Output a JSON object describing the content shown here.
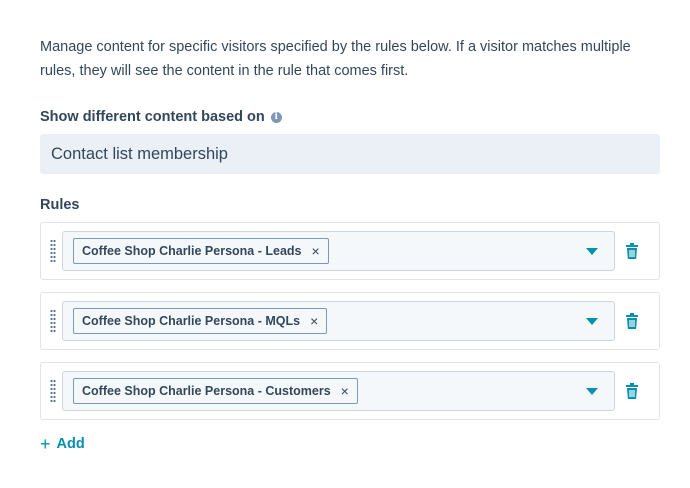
{
  "description": "Manage content for specific visitors specified by the rules below. If a visitor matches multiple rules, they will see the content in the rule that comes first.",
  "content_field": {
    "label": "Show different content based on",
    "info_icon": "i",
    "selected_value": "Contact list membership"
  },
  "rules": {
    "label": "Rules",
    "items": [
      {
        "tag": "Coffee Shop Charlie Persona - Leads",
        "remove": "×"
      },
      {
        "tag": "Coffee Shop Charlie Persona - MQLs",
        "remove": "×"
      },
      {
        "tag": "Coffee Shop Charlie Persona - Customers",
        "remove": "×"
      }
    ],
    "add_icon": "+",
    "add_label": "Add"
  },
  "colors": {
    "text": "#33475b",
    "accent": "#0091ae",
    "input_bg": "#eaf0f6",
    "border": "#dfe3eb"
  }
}
